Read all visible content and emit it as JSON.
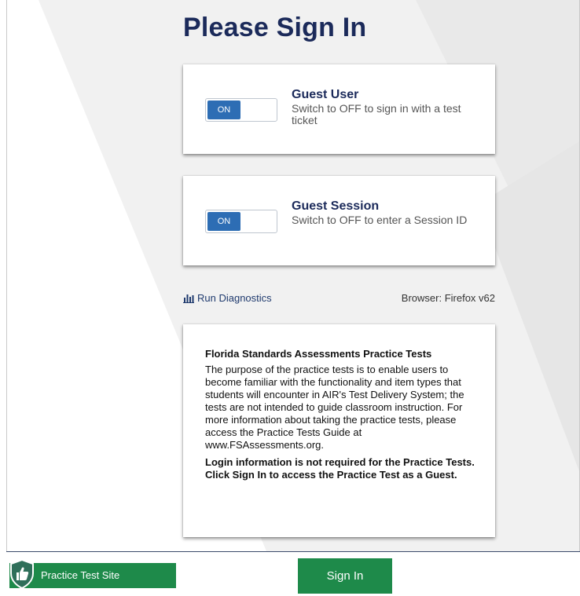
{
  "page": {
    "title": "Please Sign In"
  },
  "guest_user": {
    "toggle_label": "ON",
    "title": "Guest User",
    "description": "Switch to OFF to sign in with a test ticket"
  },
  "guest_session": {
    "toggle_label": "ON",
    "title": "Guest Session",
    "description": "Switch to OFF to enter a Session ID"
  },
  "diagnostics": {
    "label": "Run Diagnostics",
    "icon": "bar-chart-icon"
  },
  "browser": {
    "text": "Browser: Firefox v62"
  },
  "info": {
    "heading": "Florida Standards Assessments Practice Tests",
    "body": "The purpose of the practice tests is to enable users to become familiar with the functionality and item types that students will encounter in AIR's Test Delivery System; the tests are not intended to guide classroom instruction. For more information about taking the practice tests, please access the Practice Tests Guide at www.FSAssessments.org.",
    "bold_note": "Login information is not required for the Practice Tests. Click Sign In to access the Practice Test as a Guest."
  },
  "footer": {
    "site_label": "Practice Test Site",
    "site_icon": "shield-thumbs-up-icon",
    "sign_in_label": "Sign In"
  },
  "colors": {
    "title_navy": "#1b2a5a",
    "toggle_blue": "#2d6db4",
    "action_green": "#1e8a4a"
  }
}
